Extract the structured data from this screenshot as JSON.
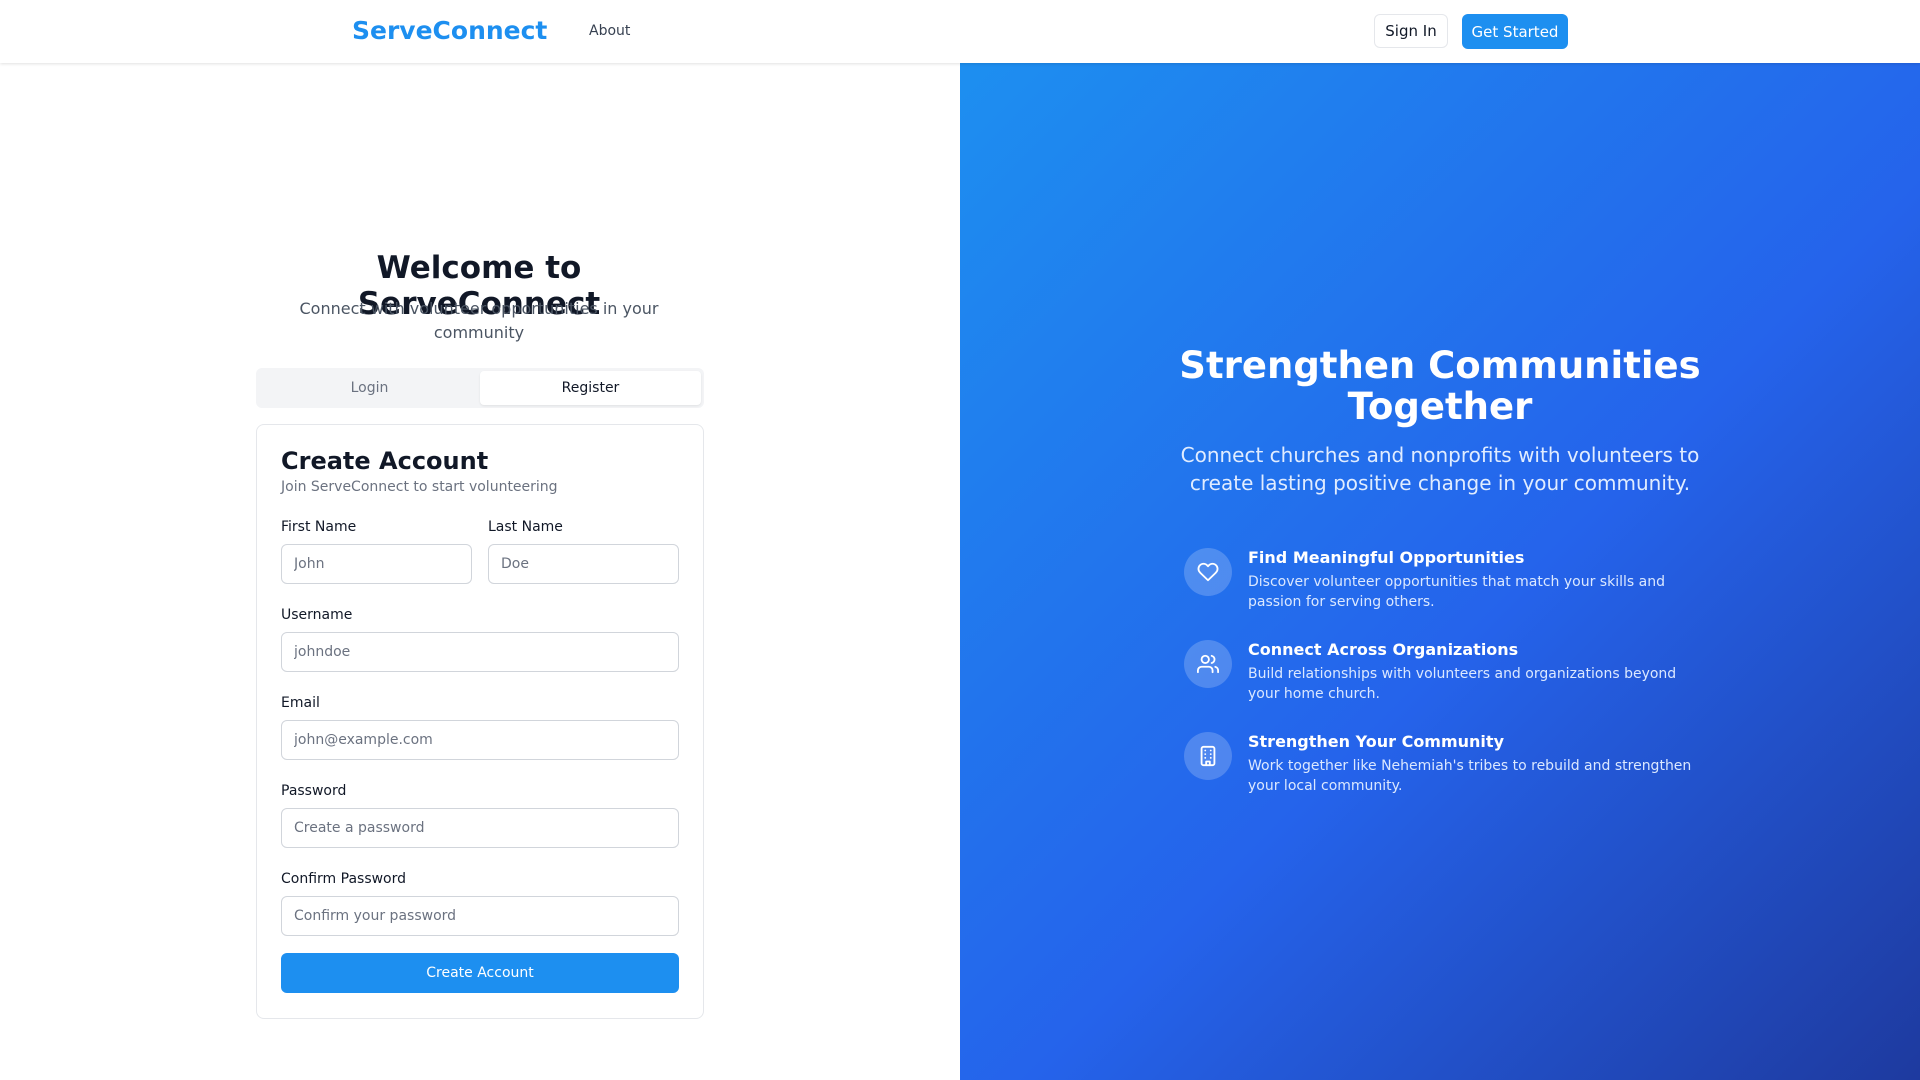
{
  "header": {
    "brand": "ServeConnect",
    "nav_about": "About",
    "sign_in": "Sign In",
    "get_started": "Get Started"
  },
  "welcome": {
    "title": "Welcome to ServeConnect",
    "subtitle": "Connect with volunteer opportunities in your community"
  },
  "tabs": [
    {
      "label": "Login",
      "active": false
    },
    {
      "label": "Register",
      "active": true
    }
  ],
  "form": {
    "title": "Create Account",
    "subtitle": "Join ServeConnect to start volunteering",
    "fields": {
      "first_name": {
        "label": "First Name",
        "placeholder": "John"
      },
      "last_name": {
        "label": "Last Name",
        "placeholder": "Doe"
      },
      "username": {
        "label": "Username",
        "placeholder": "johndoe"
      },
      "email": {
        "label": "Email",
        "placeholder": "john@example.com"
      },
      "password": {
        "label": "Password",
        "placeholder": "Create a password"
      },
      "confirm_password": {
        "label": "Confirm Password",
        "placeholder": "Confirm your password"
      }
    },
    "submit": "Create Account"
  },
  "hero": {
    "title": "Strengthen Communities Together",
    "subtitle": "Connect churches and nonprofits with volunteers to create lasting positive change in your community.",
    "features": [
      {
        "icon": "heart-icon",
        "title": "Find Meaningful Opportunities",
        "description": "Discover volunteer opportunities that match your skills and passion for serving others."
      },
      {
        "icon": "users-icon",
        "title": "Connect Across Organizations",
        "description": "Build relationships with volunteers and organizations beyond your home church."
      },
      {
        "icon": "building-icon",
        "title": "Strengthen Your Community",
        "description": "Work together like Nehemiah's tribes to rebuild and strengthen your local community."
      }
    ]
  },
  "colors": {
    "brand": "#1d8ff0",
    "gradient_start": "#1d8ff0",
    "gradient_end": "#1e3a9f"
  }
}
